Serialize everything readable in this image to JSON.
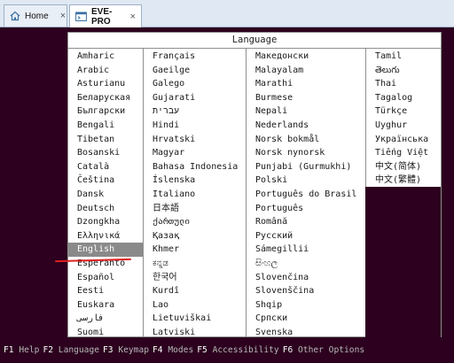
{
  "tabs": [
    {
      "label": "Home",
      "icon": "home-icon",
      "close": "×"
    },
    {
      "label": "EVE-PRO",
      "icon": "terminal-icon",
      "close": "×"
    }
  ],
  "dialog": {
    "title": "Language",
    "selected": "English",
    "columns": [
      [
        "Amharic",
        "Arabic",
        "Asturianu",
        "Беларуская",
        "Български",
        "Bengali",
        "Tibetan",
        "Bosanski",
        "Català",
        "Čeština",
        "Dansk",
        "Deutsch",
        "Dzongkha",
        "Ελληνικά",
        "English",
        "Esperanto",
        "Español",
        "Eesti",
        "Euskara",
        "فارسی",
        "Suomi"
      ],
      [
        "Français",
        "Gaeilge",
        "Galego",
        "Gujarati",
        "עברית",
        "Hindi",
        "Hrvatski",
        "Magyar",
        "Bahasa Indonesia",
        "Íslenska",
        "Italiano",
        "日本語",
        "ქართული",
        "Қазақ",
        "Khmer",
        "ಕನ್ನಡ",
        "한국어",
        "Kurdî",
        "Lao",
        "Lietuviškai",
        "Latviski"
      ],
      [
        "Македонски",
        "Malayalam",
        "Marathi",
        "Burmese",
        "Nepali",
        "Nederlands",
        "Norsk bokmål",
        "Norsk nynorsk",
        "Punjabi (Gurmukhi)",
        "Polski",
        "Português do Brasil",
        "Português",
        "Română",
        "Русский",
        "Sámegillii",
        "සිංහල",
        "Slovenčina",
        "Slovenščina",
        "Shqip",
        "Српски",
        "Svenska"
      ],
      [
        "Tamil",
        "తెలుగు",
        "Thai",
        "Tagalog",
        "Türkçe",
        "Uyghur",
        "Українська",
        "Tiếng Việt",
        "中文(简体)",
        "中文(繁體)"
      ]
    ]
  },
  "function_keys": [
    {
      "key": "F1",
      "label": "Help"
    },
    {
      "key": "F2",
      "label": "Language"
    },
    {
      "key": "F3",
      "label": "Keymap"
    },
    {
      "key": "F4",
      "label": "Modes"
    },
    {
      "key": "F5",
      "label": "Accessibility"
    },
    {
      "key": "F6",
      "label": "Other Options"
    }
  ],
  "colors": {
    "background": "#2c001e",
    "selection": "#8a8a8a",
    "annotation": "#e02020"
  }
}
